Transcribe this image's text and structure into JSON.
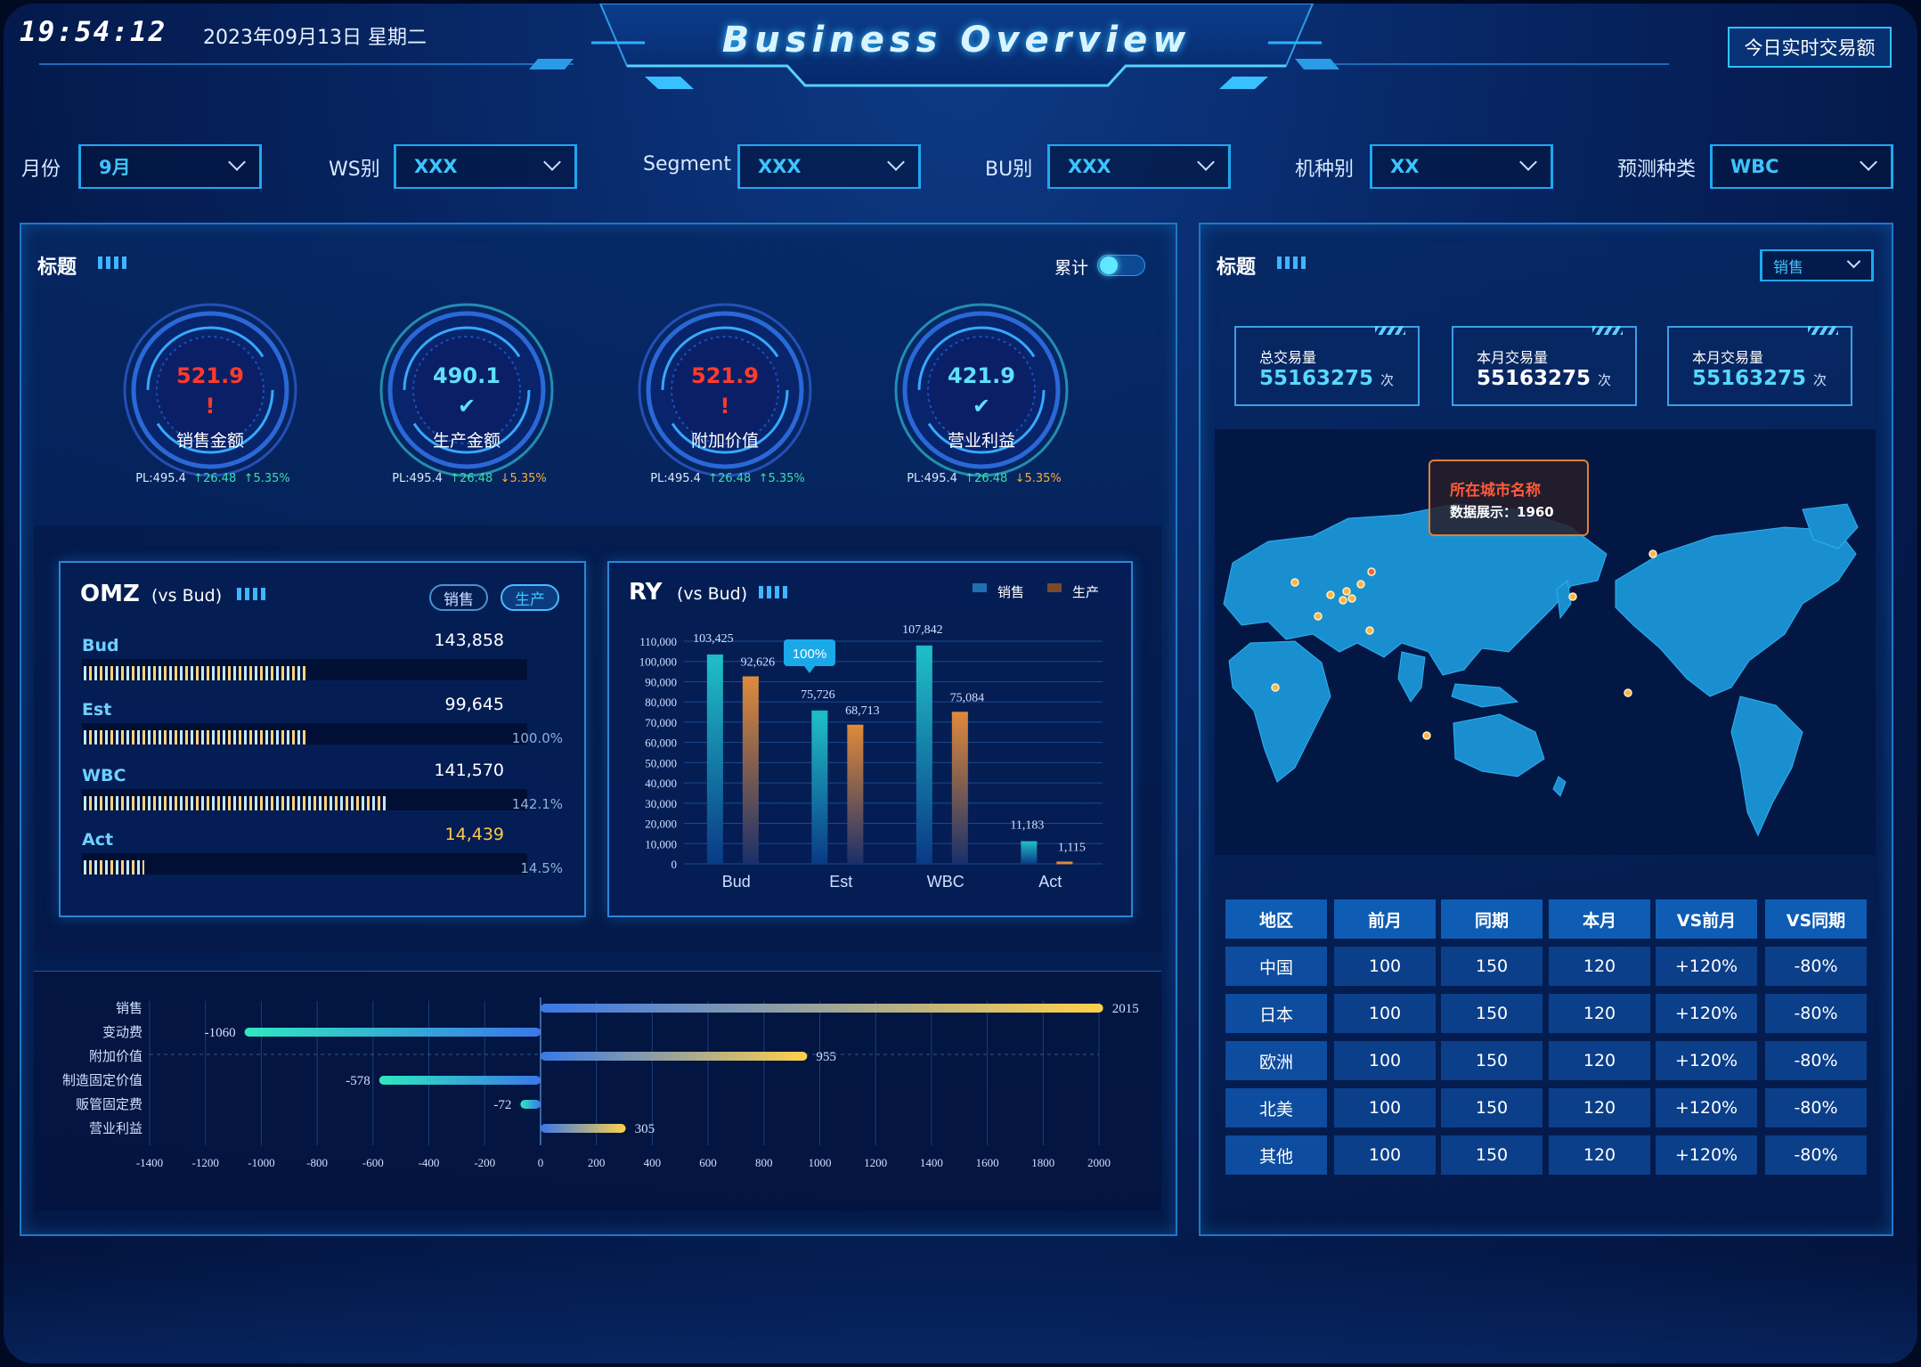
{
  "header": {
    "clock": "19:54:12",
    "date": "2023年09月13日 星期二",
    "title": "Business Overview",
    "realtime_button": "今日实时交易额"
  },
  "filters": [
    {
      "label": "月份",
      "value": "9月"
    },
    {
      "label": "WS别",
      "value": "XXX"
    },
    {
      "label": "Segment",
      "value": "XXX"
    },
    {
      "label": "BU别",
      "value": "XXX"
    },
    {
      "label": "机种别",
      "value": "XX"
    },
    {
      "label": "预测种类",
      "value": "WBC"
    }
  ],
  "left_panel": {
    "title": "标题",
    "toggle_label": "累计",
    "toggle_on": true,
    "gauges": [
      {
        "value": "521.9",
        "name": "销售金额",
        "status": "warning",
        "pl": "PL:495.4",
        "delta": "26.48",
        "pct": "5.35%",
        "pct_dir": "up",
        "color": "#ff3a2e"
      },
      {
        "value": "490.1",
        "name": "生产金额",
        "status": "ok",
        "pl": "PL:495.4",
        "delta": "26.48",
        "pct": "5.35%",
        "pct_dir": "down",
        "color": "#5fe0ff"
      },
      {
        "value": "521.9",
        "name": "附加价值",
        "status": "warning",
        "pl": "PL:495.4",
        "delta": "26.48",
        "pct": "5.35%",
        "pct_dir": "up",
        "color": "#ff3a2e"
      },
      {
        "value": "421.9",
        "name": "营业利益",
        "status": "ok",
        "pl": "PL:495.4",
        "delta": "26.48",
        "pct": "5.35%",
        "pct_dir": "down",
        "color": "#5fe0ff"
      }
    ],
    "omz": {
      "title": "OMZ",
      "subtitle": "(vs Bud)",
      "tabs": [
        "销售",
        "生产"
      ],
      "active_tab": "生产",
      "rows": [
        {
          "label": "Bud",
          "value": "143,858",
          "pct": "",
          "fill": 0.74
        },
        {
          "label": "Est",
          "value": "99,645",
          "pct": "100.0%",
          "fill": 0.74
        },
        {
          "label": "WBC",
          "value": "141,570",
          "pct": "142.1%",
          "fill": 1.0
        },
        {
          "label": "Act",
          "value": "14,439",
          "pct": "14.5%",
          "fill": 0.2,
          "highlight": true
        }
      ]
    },
    "ry": {
      "title": "RY",
      "subtitle": "(vs Bud)",
      "legend": [
        "销售",
        "生产"
      ]
    }
  },
  "chart_data": [
    {
      "type": "bar",
      "title": "RY",
      "subtitle": "(vs Bud)",
      "categories": [
        "Bud",
        "Est",
        "WBC",
        "Act"
      ],
      "series": [
        {
          "name": "销售",
          "values": [
            103425,
            75726,
            107842,
            11183
          ],
          "color": "#1fb8c8"
        },
        {
          "name": "生产",
          "values": [
            92626,
            68713,
            75084,
            1115
          ],
          "color": "#e08a3a"
        }
      ],
      "ylim": [
        0,
        110000
      ],
      "yticks": [
        "0",
        "10,000",
        "20,000",
        "30,000",
        "40,000",
        "50,000",
        "60,000",
        "70,000",
        "80,000",
        "90,000",
        "100,000",
        "110,000"
      ],
      "value_labels": [
        [
          "103,425",
          "75,726",
          "107,842",
          "11,183"
        ],
        [
          "92,626",
          "68,713",
          "75,084",
          "1,115"
        ]
      ],
      "tooltip": "100%"
    },
    {
      "type": "bar",
      "orientation": "horizontal",
      "categories": [
        "销售",
        "变动费",
        "附加价值",
        "制造固定价值",
        "贩管固定费",
        "营业利益"
      ],
      "values": [
        2015,
        -1060,
        955,
        -578,
        -72,
        305
      ],
      "value_labels": [
        "2015",
        "-1060",
        "955",
        "-578",
        "-72",
        "305"
      ],
      "xlim": [
        -1400,
        2000
      ],
      "xticks": [
        "-1400",
        "-1200",
        "-1000",
        "-800",
        "-600",
        "-400",
        "-200",
        "0",
        "200",
        "400",
        "600",
        "800",
        "1000",
        "1200",
        "1400",
        "1600",
        "1800",
        "2000"
      ]
    }
  ],
  "right_panel": {
    "title": "标题",
    "select_value": "销售",
    "kpis": [
      {
        "label": "总交易量",
        "value": "55163275",
        "unit": "次"
      },
      {
        "label": "本月交易量",
        "value": "55163275",
        "unit": "次"
      },
      {
        "label": "本月交易量",
        "value": "55163275",
        "unit": "次"
      }
    ],
    "map_tooltip": {
      "title": "所在城市名称",
      "text": "数据展示：1960"
    },
    "table": {
      "headers": [
        "地区",
        "前月",
        "同期",
        "本月",
        "VS前月",
        "VS同期"
      ],
      "rows": [
        [
          "中国",
          "100",
          "150",
          "120",
          "+120%",
          "-80%"
        ],
        [
          "日本",
          "100",
          "150",
          "120",
          "+120%",
          "-80%"
        ],
        [
          "欧洲",
          "100",
          "150",
          "120",
          "+120%",
          "-80%"
        ],
        [
          "北美",
          "100",
          "150",
          "120",
          "+120%",
          "-80%"
        ],
        [
          "其他",
          "100",
          "150",
          "120",
          "+120%",
          "-80%"
        ]
      ]
    }
  },
  "colors": {
    "accent": "#2fc3ff",
    "warning": "#ff3a2e",
    "up": "#38e0a8",
    "down": "#ffae2e",
    "map_land": "#1a8fd0"
  }
}
